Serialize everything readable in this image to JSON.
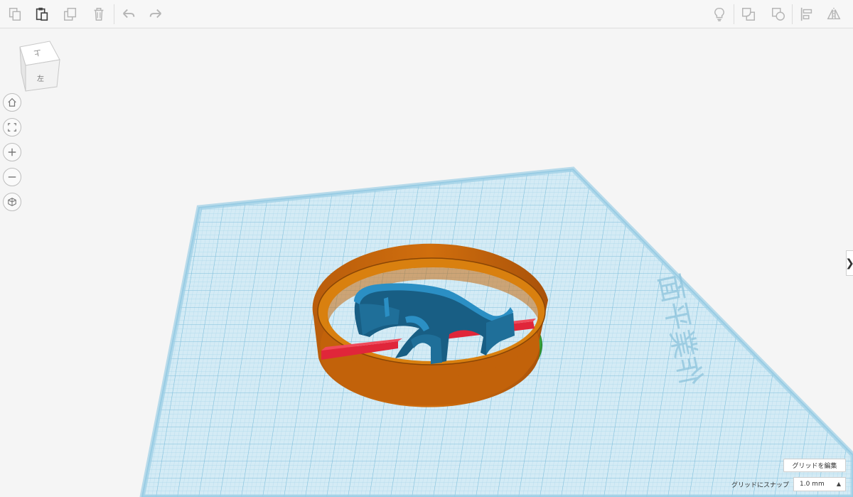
{
  "toolbar": {
    "left_icons": [
      "copy-icon",
      "paste-icon",
      "duplicate-icon",
      "delete-icon",
      "undo-icon",
      "redo-icon"
    ],
    "right_icons": [
      "lightbulb-icon",
      "group-icon",
      "ungroup-icon",
      "align-icon",
      "mirror-icon"
    ]
  },
  "viewcube": {
    "top_label": "上",
    "front_label": "左"
  },
  "nav": [
    "home-icon",
    "fit-view-icon",
    "zoom-in-icon",
    "zoom-out-icon",
    "perspective-icon"
  ],
  "workplane": {
    "watermark": "作業平面"
  },
  "panel_toggle": {
    "label": "❯"
  },
  "grid": {
    "edit_label": "グリッドを編集",
    "snap_label": "グリッドにスナップ",
    "snap_value": "1.0 mm"
  },
  "colors": {
    "grid_fill": "#d4ebf5",
    "grid_line": "#8ec6e0",
    "cutter_orange": "#c2620a",
    "cutter_inner": "#d9800f",
    "shape_blue": "#1f6f99",
    "bar_red": "#e0263a",
    "base_green": "#3aa63a"
  }
}
